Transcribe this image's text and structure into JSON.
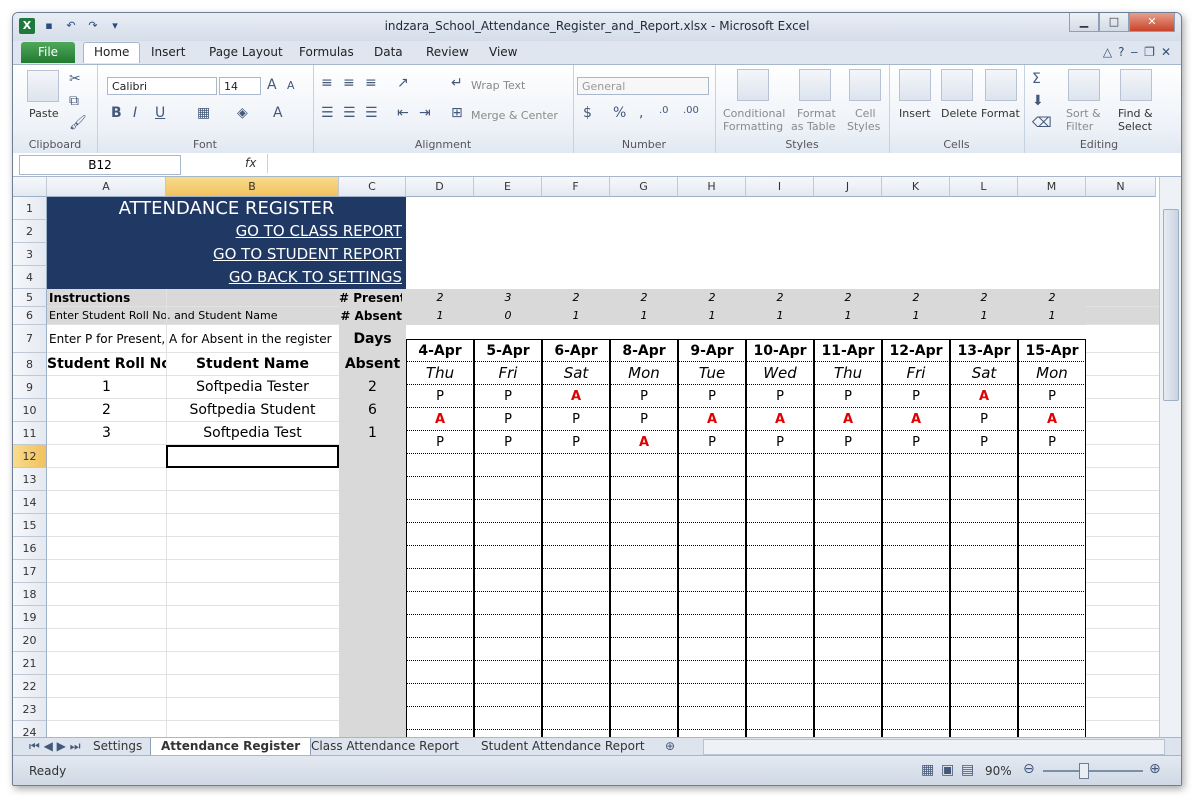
{
  "window": {
    "title": "indzara_School_Attendance_Register_and_Report.xlsx  -  Microsoft Excel"
  },
  "ribbon": {
    "file_tab": "File",
    "tabs": [
      "Home",
      "Insert",
      "Page Layout",
      "Formulas",
      "Data",
      "Review",
      "View"
    ],
    "clipboard": {
      "paste": "Paste",
      "label": "Clipboard"
    },
    "font": {
      "name": "Calibri",
      "size": "14",
      "label": "Font"
    },
    "alignment": {
      "wrap_text": "Wrap Text",
      "merge_center": "Merge & Center",
      "label": "Alignment"
    },
    "number": {
      "format": "General",
      "label": "Number"
    },
    "styles": {
      "conditional": "Conditional",
      "conditional2": "Formatting",
      "format_as": "Format",
      "format_as2": "as Table",
      "cell": "Cell",
      "cell2": "Styles",
      "label": "Styles"
    },
    "cells": {
      "insert": "Insert",
      "delete": "Delete",
      "format": "Format",
      "label": "Cells"
    },
    "editing": {
      "sort": "Sort &",
      "sort2": "Filter",
      "find": "Find &",
      "find2": "Select",
      "label": "Editing"
    }
  },
  "formula_bar": {
    "name_box": "B12",
    "fx": "fx",
    "value": ""
  },
  "columns": [
    "A",
    "B",
    "C",
    "D",
    "E",
    "F",
    "G",
    "H",
    "I",
    "J",
    "K",
    "L",
    "M",
    "N"
  ],
  "rows": [
    "1",
    "2",
    "3",
    "4",
    "5",
    "6",
    "7",
    "8",
    "9",
    "10",
    "11",
    "12",
    "13",
    "14",
    "15",
    "16",
    "17",
    "18",
    "19",
    "20",
    "21",
    "22",
    "23",
    "24"
  ],
  "header": {
    "title": "ATTENDANCE REGISTER",
    "link_class": "GO TO CLASS REPORT",
    "link_student": "GO TO STUDENT REPORT",
    "link_settings": "GO BACK TO SETTINGS"
  },
  "labels": {
    "instructions": "Instructions",
    "instr1": "Enter Student Roll No. and Student Name",
    "instr2": "Enter P for Present, A for Absent in the register",
    "present": "# Present",
    "absent": "# Absent",
    "days": "Days",
    "days_absent": "Absent",
    "roll_no": "Student Roll No.",
    "student_name": "Student Name"
  },
  "dates": [
    {
      "date": "4-Apr",
      "day": "Thu",
      "present": "2",
      "absent": "1"
    },
    {
      "date": "5-Apr",
      "day": "Fri",
      "present": "3",
      "absent": "0"
    },
    {
      "date": "6-Apr",
      "day": "Sat",
      "present": "2",
      "absent": "1"
    },
    {
      "date": "8-Apr",
      "day": "Mon",
      "present": "2",
      "absent": "1"
    },
    {
      "date": "9-Apr",
      "day": "Tue",
      "present": "2",
      "absent": "1"
    },
    {
      "date": "10-Apr",
      "day": "Wed",
      "present": "2",
      "absent": "1"
    },
    {
      "date": "11-Apr",
      "day": "Thu",
      "present": "2",
      "absent": "1"
    },
    {
      "date": "12-Apr",
      "day": "Fri",
      "present": "2",
      "absent": "1"
    },
    {
      "date": "13-Apr",
      "day": "Sat",
      "present": "2",
      "absent": "1"
    },
    {
      "date": "15-Apr",
      "day": "Mon",
      "present": "2",
      "absent": "1"
    }
  ],
  "students": [
    {
      "roll": "1",
      "name": "Softpedia Tester",
      "absent": "2",
      "marks": [
        "P",
        "P",
        "A",
        "P",
        "P",
        "P",
        "P",
        "P",
        "A",
        "P"
      ]
    },
    {
      "roll": "2",
      "name": "Softpedia Student",
      "absent": "6",
      "marks": [
        "A",
        "P",
        "P",
        "P",
        "A",
        "A",
        "A",
        "A",
        "P",
        "A"
      ]
    },
    {
      "roll": "3",
      "name": "Softpedia Test",
      "absent": "1",
      "marks": [
        "P",
        "P",
        "P",
        "A",
        "P",
        "P",
        "P",
        "P",
        "P",
        "P"
      ]
    }
  ],
  "sheet_tabs": [
    "Settings",
    "Attendance Register",
    "Class Attendance Report",
    "Student Attendance Report"
  ],
  "status": {
    "ready": "Ready",
    "zoom": "90%"
  },
  "colors": {
    "navy": "#1f3864",
    "absent_red": "#e00000",
    "gray_fill": "#d9d9d9",
    "selected_header": "#f1c15f"
  }
}
